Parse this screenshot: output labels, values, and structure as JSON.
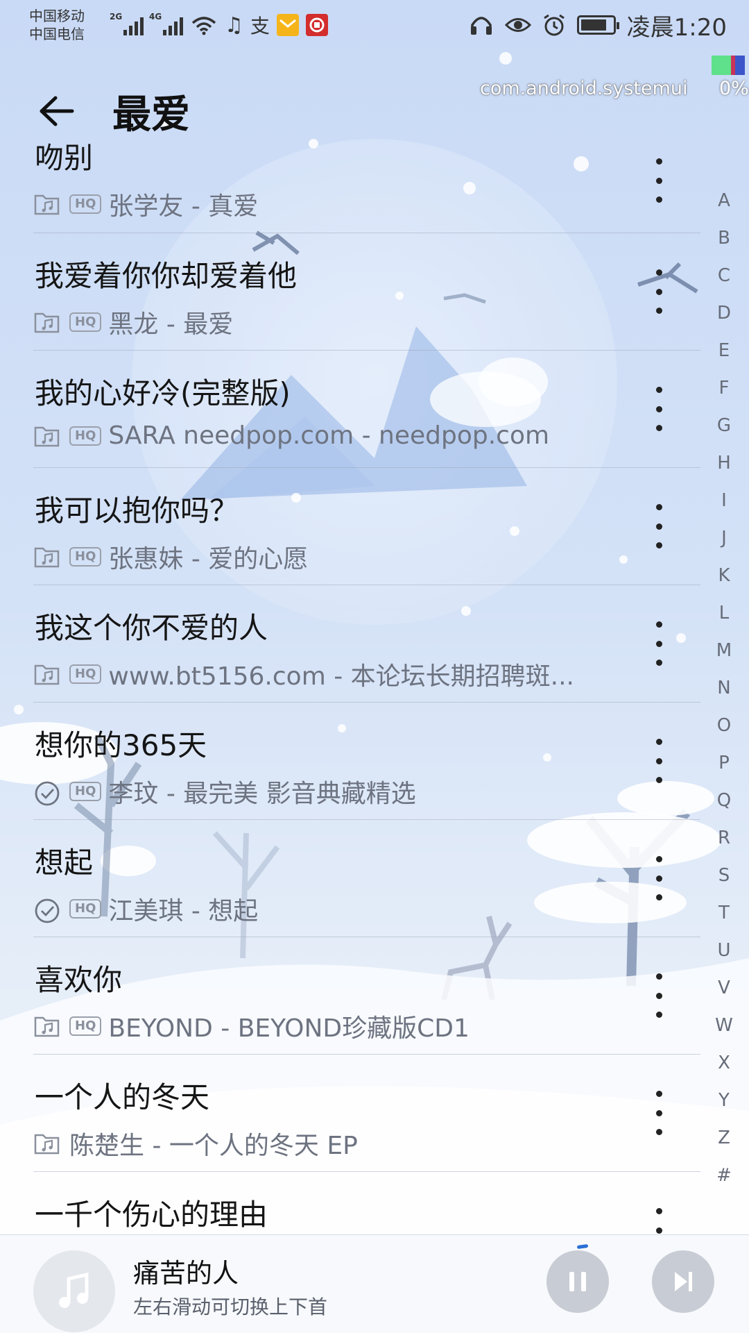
{
  "status_bar": {
    "carrier1": "中国移动",
    "carrier2": "中国电信",
    "net1": "2G",
    "net2": "4G",
    "time": "凌晨1:20",
    "icons": [
      "signal-icon",
      "wifi-icon",
      "music-icon",
      "alipay-icon",
      "mail-icon",
      "bank-icon",
      "headphones-icon",
      "eye-icon",
      "alarm-icon",
      "battery-icon"
    ]
  },
  "overlay": {
    "package": "com.android.systemui",
    "percent": "0%"
  },
  "header": {
    "title": "最爱",
    "back_icon": "arrow-left-icon"
  },
  "songs": [
    {
      "title": "吻别",
      "subtitle": "张学友 - 真爱",
      "source_icon": "folder-music-icon",
      "hq": "HQ"
    },
    {
      "title": "我爱着你你却爱着他",
      "subtitle": "黑龙 - 最爱",
      "source_icon": "folder-music-icon",
      "hq": "HQ"
    },
    {
      "title": "我的心好冷(完整版)",
      "subtitle": "SARA needpop.com - needpop.com",
      "source_icon": "folder-music-icon",
      "hq": "HQ"
    },
    {
      "title": "我可以抱你吗？",
      "subtitle": "张惠妹 - 爱的心愿",
      "source_icon": "folder-music-icon",
      "hq": "HQ"
    },
    {
      "title": "我这个你不爱的人",
      "subtitle": "www.bt5156.com - 本论坛长期招聘斑...",
      "source_icon": "folder-music-icon",
      "hq": "HQ"
    },
    {
      "title": "想你的365天",
      "subtitle": "李玟 - 最完美 影音典藏精选",
      "source_icon": "check-circle-icon",
      "hq": "HQ"
    },
    {
      "title": "想起",
      "subtitle": "江美琪 - 想起",
      "source_icon": "check-circle-icon",
      "hq": "HQ"
    },
    {
      "title": "喜欢你",
      "subtitle": "BEYOND - BEYOND珍藏版CD1",
      "source_icon": "folder-music-icon",
      "hq": "HQ"
    },
    {
      "title": "一个人的冬天",
      "subtitle": "陈楚生 - 一个人的冬天 EP",
      "source_icon": "folder-music-icon",
      "hq": ""
    },
    {
      "title": "一千个伤心的理由",
      "subtitle": "",
      "source_icon": "",
      "hq": ""
    }
  ],
  "alpha_index": [
    "A",
    "B",
    "C",
    "D",
    "E",
    "F",
    "G",
    "H",
    "I",
    "J",
    "K",
    "L",
    "M",
    "N",
    "O",
    "P",
    "Q",
    "R",
    "S",
    "T",
    "U",
    "V",
    "W",
    "X",
    "Y",
    "Z",
    "#"
  ],
  "player": {
    "title": "痛苦的人",
    "hint": "左右滑动可切换上下首",
    "album_icon": "music-note-icon",
    "pause_icon": "pause-icon",
    "next_icon": "skip-next-icon"
  }
}
